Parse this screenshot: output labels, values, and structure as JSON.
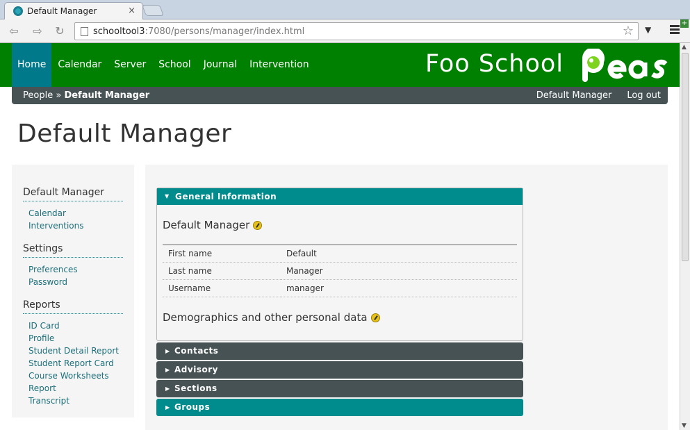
{
  "browser": {
    "tab_title": "Default Manager",
    "tab_close": "×",
    "url_host": "schooltool3",
    "url_rest": ":7080/persons/manager/index.html",
    "back_icon": "back-icon",
    "forward_icon": "forward-icon",
    "reload_icon": "reload-icon"
  },
  "header": {
    "nav": [
      "Home",
      "Calendar",
      "Server",
      "School",
      "Journal",
      "Intervention"
    ],
    "active_nav": "Home",
    "school_name": "Foo School",
    "logo_text": "Peas"
  },
  "breadcrumb": {
    "parent": "People",
    "separator": "»",
    "current": "Default Manager",
    "user": "Default Manager",
    "logout": "Log out"
  },
  "page_title": "Default Manager",
  "sidebar": {
    "sections": [
      {
        "title": "Default Manager",
        "links": [
          "Calendar",
          "Interventions"
        ]
      },
      {
        "title": "Settings",
        "links": [
          "Preferences",
          "Password"
        ]
      },
      {
        "title": "Reports",
        "links": [
          "ID Card",
          "Profile",
          "Student Detail Report",
          "Student Report Card",
          "Course Worksheets Report",
          "Transcript"
        ]
      }
    ]
  },
  "general": {
    "header": "General Information",
    "person_name": "Default Manager",
    "rows": [
      {
        "label": "First name",
        "value": "Default"
      },
      {
        "label": "Last name",
        "value": "Manager"
      },
      {
        "label": "Username",
        "value": "manager"
      }
    ],
    "demographics": "Demographics and other personal data"
  },
  "collapsed_panels": [
    "Contacts",
    "Advisory",
    "Sections",
    "Groups"
  ],
  "colors": {
    "green": "#008000",
    "teal": "#008c8c",
    "dark": "#465254"
  }
}
